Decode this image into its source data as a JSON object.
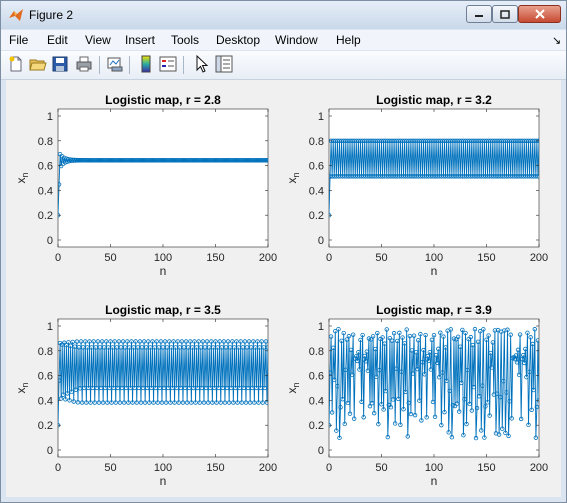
{
  "window": {
    "title": "Figure 2"
  },
  "menu": [
    "File",
    "Edit",
    "View",
    "Insert",
    "Tools",
    "Desktop",
    "Window",
    "Help"
  ],
  "dock_arrow": "↘",
  "toolbar": {
    "icons": [
      "new-figure-icon",
      "open-file-icon",
      "save-icon",
      "print-icon",
      "link-plot-icon",
      "colorbar-icon",
      "legend-icon",
      "pointer-icon",
      "property-inspector-icon"
    ]
  },
  "colors": {
    "line": "#0072bd"
  },
  "chart_data": [
    {
      "type": "line",
      "title": "Logistic map, r = 2.8",
      "r": 2.8,
      "x0": 0.2,
      "n_points": 201,
      "xlabel": "n",
      "ylabel": "x",
      "ylabel_sub": "n",
      "xlim": [
        0,
        200
      ],
      "ylim": [
        0,
        1
      ],
      "xticks": [
        0,
        50,
        100,
        150,
        200
      ],
      "yticks": [
        0,
        0.2,
        0.4,
        0.6,
        0.8,
        1
      ],
      "yticklabels": [
        "0",
        "0.2",
        "0.4",
        "0.6",
        "0.8",
        "1"
      ],
      "marker": "circle"
    },
    {
      "type": "line",
      "title": "Logistic map, r = 3.2",
      "r": 3.2,
      "x0": 0.2,
      "n_points": 201,
      "xlabel": "n",
      "ylabel": "x",
      "ylabel_sub": "n",
      "xlim": [
        0,
        200
      ],
      "ylim": [
        0,
        1
      ],
      "xticks": [
        0,
        50,
        100,
        150,
        200
      ],
      "yticks": [
        0,
        0.2,
        0.4,
        0.6,
        0.8,
        1
      ],
      "yticklabels": [
        "0",
        "0.2",
        "0.4",
        "0.6",
        "0.8",
        "1"
      ],
      "marker": "circle"
    },
    {
      "type": "line",
      "title": "Logistic map, r = 3.5",
      "r": 3.5,
      "x0": 0.2,
      "n_points": 201,
      "xlabel": "n",
      "ylabel": "x",
      "ylabel_sub": "n",
      "xlim": [
        0,
        200
      ],
      "ylim": [
        0,
        1
      ],
      "xticks": [
        0,
        50,
        100,
        150,
        200
      ],
      "yticks": [
        0,
        0.2,
        0.4,
        0.6,
        0.8,
        1
      ],
      "yticklabels": [
        "0",
        "0.2",
        "0.4",
        "0.6",
        "0.8",
        "1"
      ],
      "marker": "circle"
    },
    {
      "type": "line",
      "title": "Logistic map, r = 3.9",
      "r": 3.9,
      "x0": 0.2,
      "n_points": 201,
      "xlabel": "n",
      "ylabel": "x",
      "ylabel_sub": "n",
      "xlim": [
        0,
        200
      ],
      "ylim": [
        0,
        1
      ],
      "xticks": [
        0,
        50,
        100,
        150,
        200
      ],
      "yticks": [
        0,
        0.2,
        0.4,
        0.6,
        0.8,
        1
      ],
      "yticklabels": [
        "0",
        "0.2",
        "0.4",
        "0.6",
        "0.8",
        "1"
      ],
      "marker": "circle"
    }
  ]
}
